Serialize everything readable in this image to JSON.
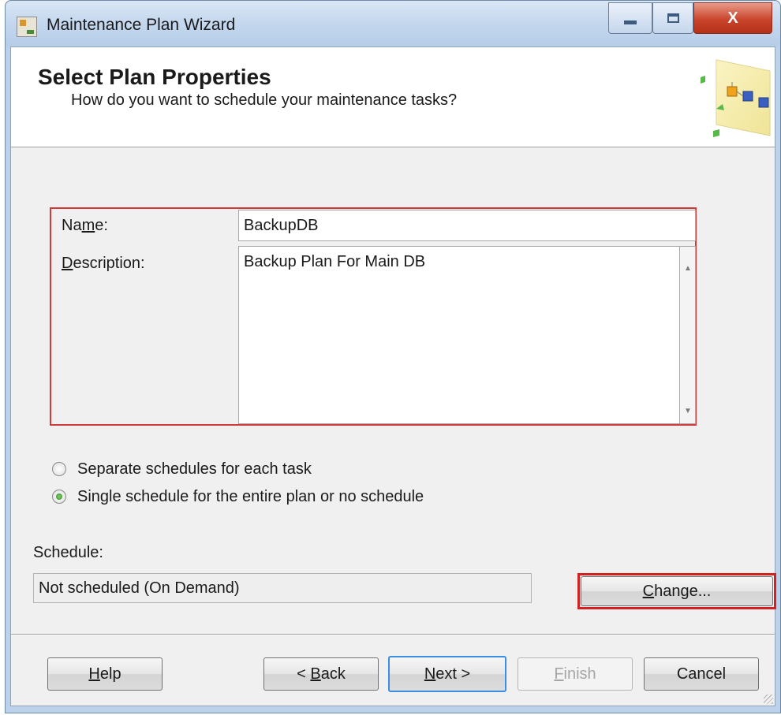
{
  "window": {
    "title": "Maintenance Plan Wizard",
    "close_glyph": "X"
  },
  "header": {
    "title": "Select Plan Properties",
    "subtitle": "How do you want to schedule your maintenance tasks?"
  },
  "form": {
    "name_label_pre": "Na",
    "name_label_u": "m",
    "name_label_post": "e:",
    "name_value": "BackupDB",
    "description_label_u": "D",
    "description_label_post": "escription:",
    "description_value": "Backup Plan For Main DB"
  },
  "schedule_options": {
    "separate_label": "Separate schedules for each task",
    "single_label": "Single schedule for the entire plan or no schedule",
    "selected": "single"
  },
  "schedule": {
    "label": "Schedule:",
    "value": "Not scheduled (On Demand)",
    "change_u": "C",
    "change_post": "hange..."
  },
  "buttons": {
    "help_u": "H",
    "help_post": "elp",
    "back_pre": "< ",
    "back_u": "B",
    "back_post": "ack",
    "next_u": "N",
    "next_post": "ext >",
    "finish_u": "F",
    "finish_post": "inish",
    "cancel": "Cancel"
  },
  "colors": {
    "highlight": "#d42020",
    "default_button_border": "#3d8ee0"
  },
  "icons": [
    "wizard-app-icon",
    "minimize-icon",
    "maximize-icon",
    "close-icon",
    "maintenance-plan-graphic",
    "scroll-up-arrow-icon",
    "scroll-down-arrow-icon",
    "resize-grip-icon"
  ]
}
